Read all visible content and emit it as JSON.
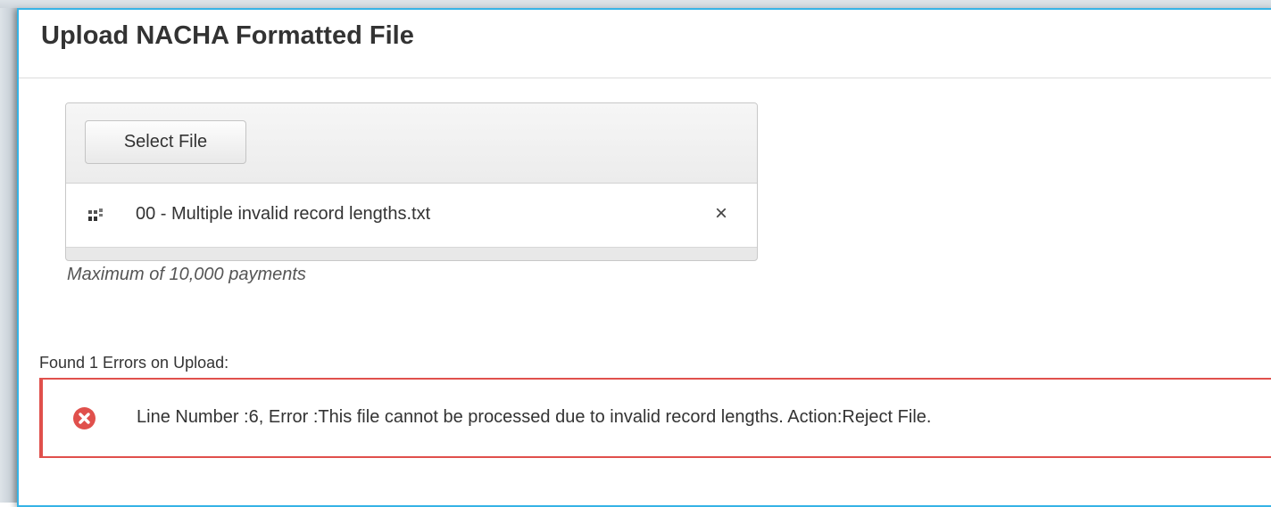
{
  "header": {
    "title": "Upload NACHA Formatted File"
  },
  "upload": {
    "select_label": "Select File",
    "file_name": "00 - Multiple invalid record lengths.txt",
    "remove_symbol": "×",
    "hint": "Maximum of 10,000 payments"
  },
  "errors": {
    "summary": "Found 1 Errors on Upload:",
    "items": [
      {
        "message": "Line Number :6, Error :This file cannot be processed due to invalid record lengths. Action:Reject File.",
        "icon": "error-circle-x-icon"
      }
    ]
  },
  "colors": {
    "accent_border": "#36b3e6",
    "error_red": "#e0504c",
    "text": "#333333"
  }
}
